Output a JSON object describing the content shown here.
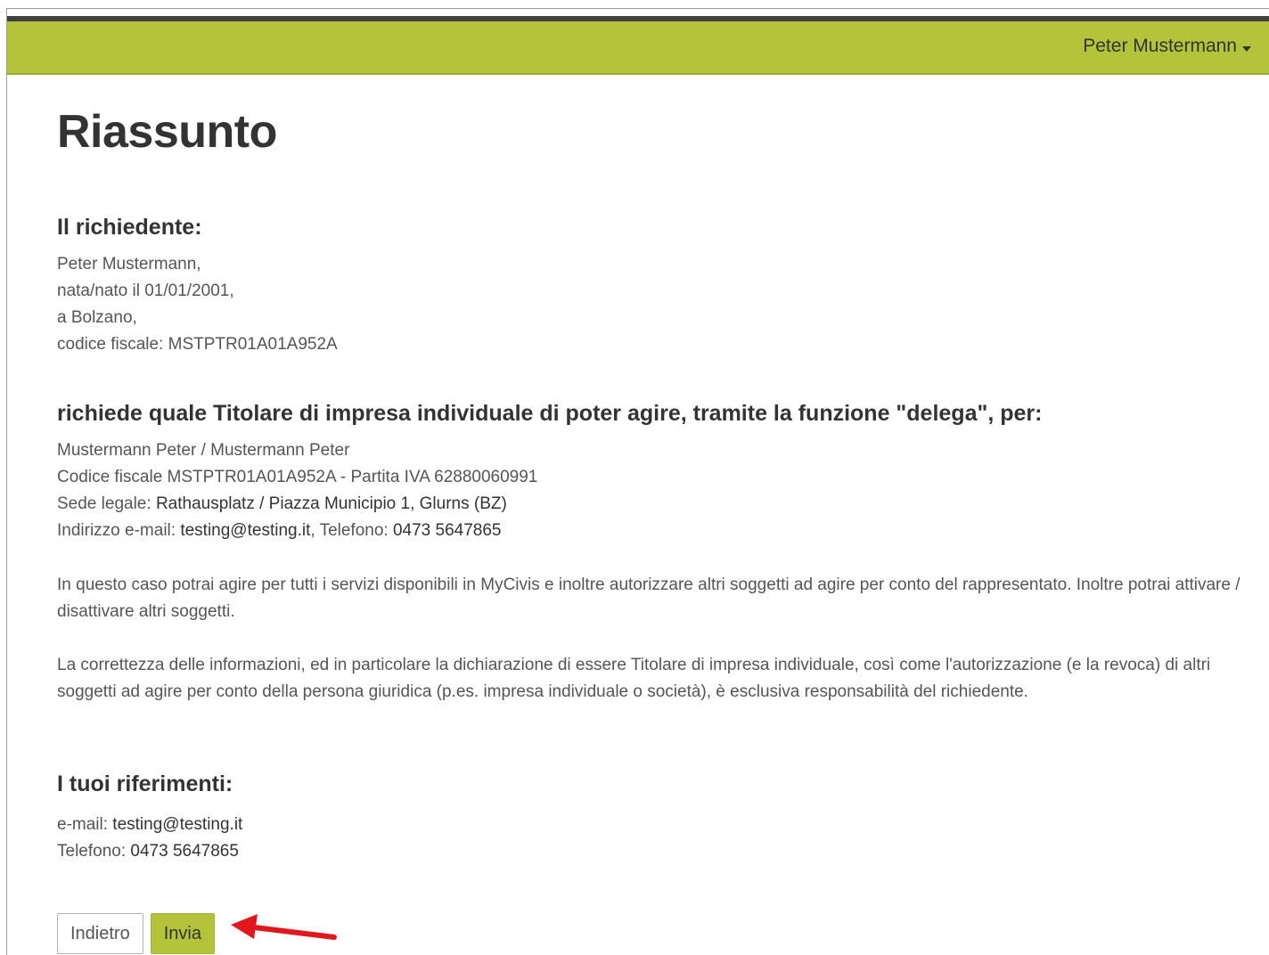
{
  "header": {
    "user_name": "Peter Mustermann"
  },
  "page": {
    "title": "Riassunto"
  },
  "applicant": {
    "heading": "Il richiedente:",
    "name_line": "Peter Mustermann,",
    "birth_line": "nata/nato il 01/01/2001,",
    "place_line": "a Bolzano,",
    "tax_code_line": "codice fiscale: MSTPTR01A01A952A"
  },
  "request": {
    "heading": "richiede quale Titolare di impresa individuale di poter agire, tramite la funzione \"delega\", per:",
    "company_line": "Mustermann Peter / Mustermann Peter",
    "codes_line": "Codice fiscale MSTPTR01A01A952A - Partita IVA 62880060991",
    "address_label": "Sede legale:",
    "address_value": "Rathausplatz / Piazza Municipio 1, Glurns (BZ)",
    "email_label": "Indirizzo e-mail:",
    "email_value": "testing@testing.it",
    "phone_separator": ",",
    "phone_label": "Telefono:",
    "phone_value": "0473 5647865"
  },
  "info": {
    "paragraph1": "In questo caso potrai agire per tutti i servizi disponibili in MyCivis e inoltre autorizzare altri soggetti ad agire per conto del rappresentato. Inoltre potrai attivare / disattivare altri soggetti.",
    "paragraph2": "La correttezza delle informazioni, ed in particolare la dichiarazione di essere Titolare di impresa individuale, così come l'autorizzazione (e la revoca) di altri soggetti ad agire per conto della persona giuridica (p.es. impresa individuale o società), è esclusiva responsabilità del richiedente."
  },
  "references": {
    "heading": "I tuoi riferimenti:",
    "email_label": "e-mail:",
    "email_value": "testing@testing.it",
    "phone_label": "Telefono:",
    "phone_value": "0473 5647865"
  },
  "actions": {
    "back_label": "Indietro",
    "send_label": "Invia"
  },
  "colors": {
    "brand_green": "#b3c43a",
    "annotation_arrow": "#e0171b"
  }
}
